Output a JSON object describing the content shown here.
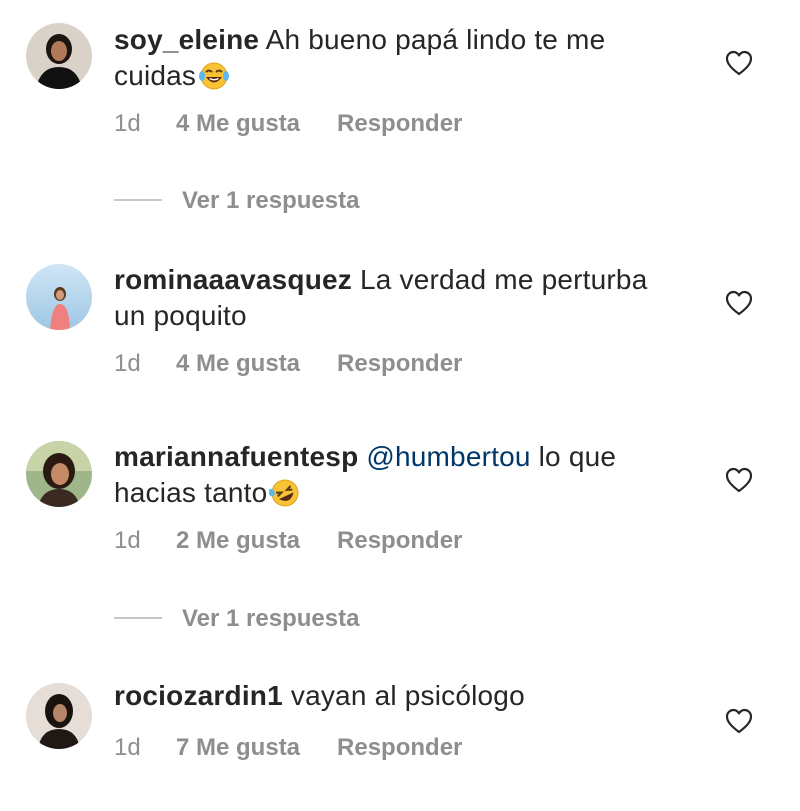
{
  "comments": [
    {
      "username": "soy_eleine",
      "text": "Ah bueno papá lindo te me cuidas",
      "emoji": "laughing-with-tears",
      "time": "1d",
      "likes": "4 Me gusta",
      "reply": "Responder",
      "view_replies": "Ver 1 respuesta"
    },
    {
      "username": "rominaaavasquez",
      "text": "La verdad me perturba un poquito",
      "time": "1d",
      "likes": "4 Me gusta",
      "reply": "Responder"
    },
    {
      "username": "mariannafuentesp",
      "mention": "@humbertou",
      "text": "lo que hacias tanto",
      "emoji": "rolling-on-floor-laughing",
      "time": "1d",
      "likes": "2 Me gusta",
      "reply": "Responder",
      "view_replies": "Ver 1 respuesta"
    },
    {
      "username": "rociozardin1",
      "text": "vayan al psicólogo",
      "time": "1d",
      "likes": "7 Me gusta",
      "reply": "Responder"
    }
  ],
  "colors": {
    "text": "#262626",
    "secondary": "#8e8e8e",
    "mention": "#00376b",
    "divider": "#c7c7c7"
  }
}
